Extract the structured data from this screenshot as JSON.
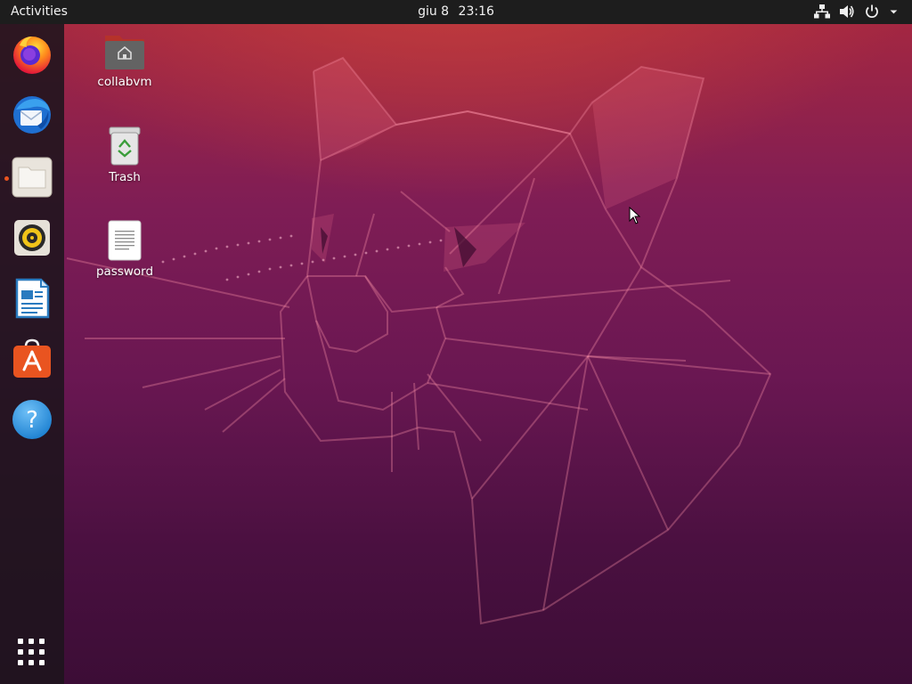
{
  "topbar": {
    "activities_label": "Activities",
    "date": "giu 8",
    "time": "23:16",
    "tray": [
      {
        "icon": "network-wired-icon"
      },
      {
        "icon": "volume-icon"
      },
      {
        "icon": "power-icon"
      },
      {
        "icon": "system-menu-chevron-icon"
      }
    ]
  },
  "dock": {
    "items": [
      {
        "name": "Firefox",
        "icon": "firefox-icon",
        "running": false
      },
      {
        "name": "Thunderbird",
        "icon": "thunderbird-icon",
        "running": false
      },
      {
        "name": "Files",
        "icon": "files-icon",
        "running": true
      },
      {
        "name": "Rhythmbox",
        "icon": "rhythmbox-icon",
        "running": false
      },
      {
        "name": "LibreOffice Writer",
        "icon": "writer-icon",
        "running": false
      },
      {
        "name": "Ubuntu Software",
        "icon": "software-icon",
        "running": false
      },
      {
        "name": "Help",
        "icon": "help-icon",
        "running": false
      }
    ],
    "show_apps_icon": "show-applications-icon"
  },
  "desktop": {
    "icons": [
      {
        "label": "collabvm",
        "icon": "home-folder-icon"
      },
      {
        "label": "Trash",
        "icon": "trash-icon"
      },
      {
        "label": "password",
        "icon": "text-file-icon"
      }
    ]
  },
  "colors": {
    "topbar_bg": "#1d1d1d",
    "accent": "#e95420",
    "wallpaper_top": "#a8283f",
    "wallpaper_bottom": "#3c0d36"
  }
}
